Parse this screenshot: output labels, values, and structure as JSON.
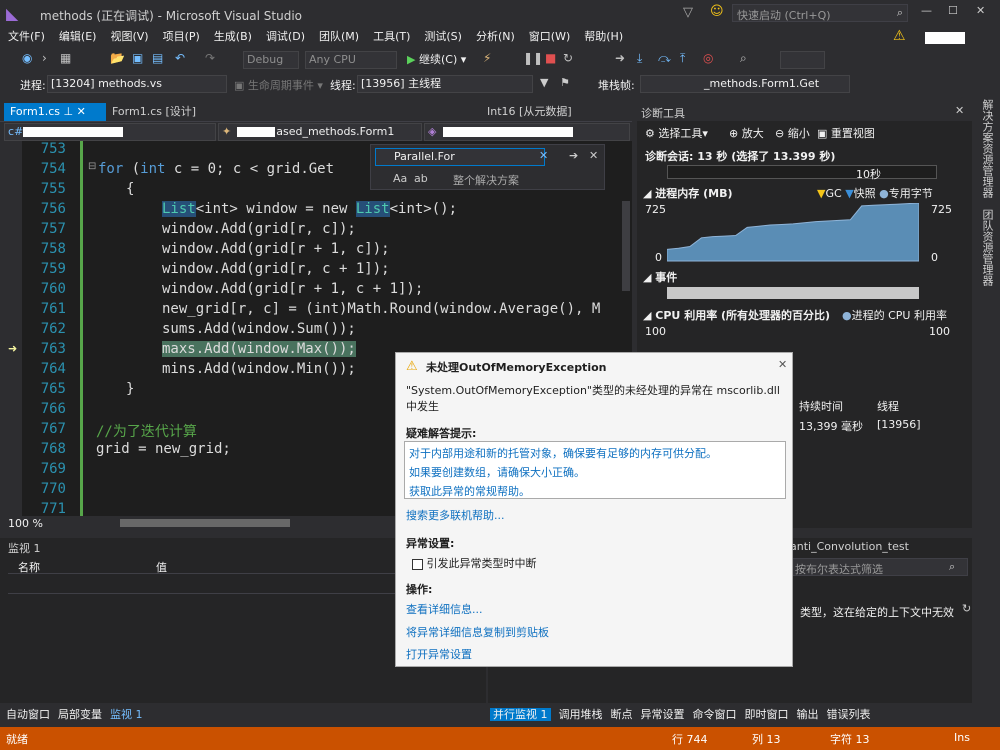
{
  "title": "methods (正在调试) - Microsoft Visual Studio",
  "quick_launch_placeholder": "快速启动 (Ctrl+Q)",
  "menu": [
    "文件(F)",
    "编辑(E)",
    "视图(V)",
    "项目(P)",
    "生成(B)",
    "调试(D)",
    "团队(M)",
    "工具(T)",
    "测试(S)",
    "分析(N)",
    "窗口(W)",
    "帮助(H)"
  ],
  "toolbar": {
    "config": "Debug",
    "platform": "Any CPU",
    "continue": "继续(C)"
  },
  "debug_bar": {
    "process_label": "进程:",
    "process_value": "[13204] methods.vs",
    "lifecycle": "生命周期事件",
    "thread_label": "线程:",
    "thread_value": "[13956] 主线程",
    "stack_label": "堆栈帧:",
    "stack_value": "_methods.Form1.Get"
  },
  "editor_tabs": [
    {
      "label": "Form1.cs",
      "active": true
    },
    {
      "label": "Form1.cs [设计]",
      "active": false
    },
    {
      "label": "Int16 [从元数据]",
      "active": false
    }
  ],
  "nav": {
    "left": "",
    "middle": "ased_methods.Form1",
    "right": ""
  },
  "parallel_popup": {
    "title": "Parallel.For",
    "scope": "整个解决方案"
  },
  "line_numbers": [
    "753",
    "754",
    "755",
    "756",
    "757",
    "758",
    "759",
    "760",
    "761",
    "762",
    "763",
    "764",
    "765",
    "766",
    "767",
    "768",
    "769",
    "770",
    "771"
  ],
  "code": {
    "l754": "for (int c = 0; c < grid.Get",
    "l756a": "List",
    "l756b": "<int> window = new ",
    "l756c": "List",
    "l756d": "<int>();",
    "l757": "window.Add(grid[r, c]);",
    "l758": "window.Add(grid[r + 1, c]);",
    "l759": "window.Add(grid[r, c + 1]);",
    "l760": "window.Add(grid[r + 1, c + 1]);",
    "l761": "new_grid[r, c] = (int)Math.Round(window.Average(), M",
    "l762": "sums.Add(window.Sum());",
    "l763": "maxs.Add(window.Max());",
    "l764": "mins.Add(window.Min());",
    "l765": "}",
    "l767": "//为了迭代计算",
    "l768": "grid = new_grid;",
    "l755": "{"
  },
  "zoom": "100 %",
  "diag": {
    "title": "诊断工具",
    "select_tool": "选择工具",
    "zoom_in": "放大",
    "zoom_out": "缩小",
    "reset_view": "重置视图",
    "session": "诊断会话: 13 秒 (选择了 13.399 秒)",
    "tick": "10秒",
    "mem_title": "进程内存 (MB)",
    "gc": "GC",
    "snapshot": "快照",
    "private_bytes": "专用字节",
    "mem_max": "725",
    "mem_min": "0",
    "events": "事件",
    "cpu_title": "CPU 利用率 (所有处理器的百分比)",
    "cpu_legend": "进程的 CPU 利用率",
    "cpu_max": "100",
    "col_duration": "持续时间",
    "col_thread": "线程",
    "row_duration": "13,399 毫秒",
    "row_thread": "[13956]",
    "memory_series": [
      20,
      22,
      25,
      40,
      42,
      43,
      44,
      58,
      60,
      62,
      63,
      64,
      66,
      68,
      69,
      70,
      71,
      95,
      96,
      97,
      98,
      99,
      100
    ]
  },
  "exception": {
    "title": "未处理OutOfMemoryException",
    "desc": "\"System.OutOfMemoryException\"类型的未经处理的异常在 mscorlib.dll 中发生",
    "tips_title": "疑难解答提示:",
    "tips": [
      "对于内部用途和新的托管对象，确保要有足够的内存可供分配。",
      "如果要创建数组，请确保大小正确。",
      "获取此异常的常规帮助。"
    ],
    "search_more": "搜索更多联机帮助...",
    "settings_title": "异常设置:",
    "break_checkbox": "引发此异常类型时中断",
    "actions_title": "操作:",
    "actions": [
      "查看详细信息...",
      "将异常详细信息复制到剪贴板",
      "打开异常设置"
    ]
  },
  "watch": {
    "title": "监视 1",
    "col_name": "名称",
    "col_value": "值"
  },
  "right_panel": {
    "title": "anti_Convolution_test",
    "search_placeholder": "按布尔表达式筛选",
    "message": "类型，这在给定的上下文中无效"
  },
  "bottom_tabs_left": [
    "自动窗口",
    "局部变量",
    "监视 1"
  ],
  "bottom_tabs_right": [
    "并行监视 1",
    "调用堆栈",
    "断点",
    "异常设置",
    "命令窗口",
    "即时窗口",
    "输出",
    "错误列表"
  ],
  "status": {
    "ready": "就绪",
    "line": "行 744",
    "col": "列 13",
    "char": "字符 13",
    "ins": "Ins"
  },
  "side_tabs": [
    "解决方案资源管理器",
    "团队资源管理器"
  ],
  "accent": "#ca5100"
}
